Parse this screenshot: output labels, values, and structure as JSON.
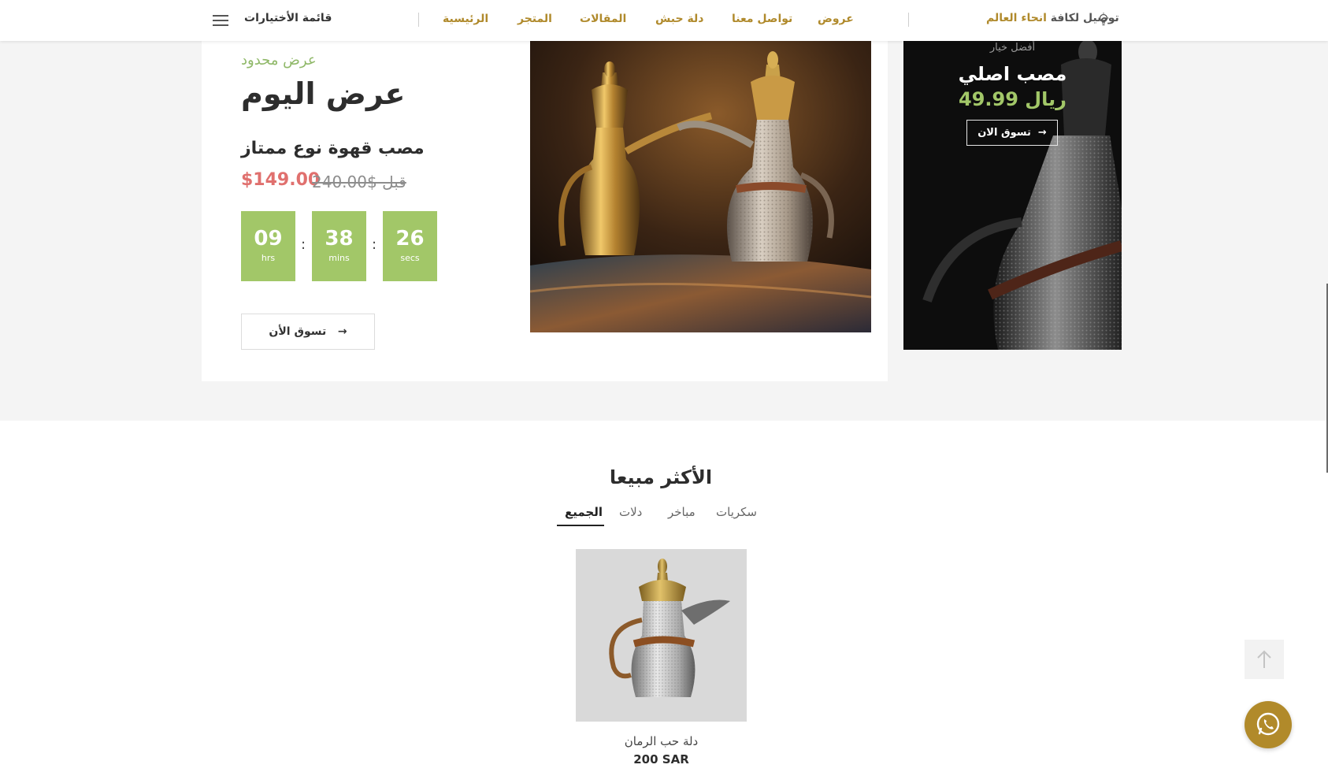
{
  "nav": {
    "menu_label": "قائمة الأختيارات",
    "items": [
      "الرئيسية",
      "المتجر",
      "المقالات",
      "دلة حبش",
      "تواصل معنا",
      "عروض"
    ],
    "shipping_prefix": "توصيل لكافة",
    "shipping_accent": "انحاء العالم"
  },
  "deal": {
    "subtitle": "عرض محدود",
    "title": "عرض اليوم",
    "product": "مصب قهوة نوع ممتاز",
    "price": "$149.00",
    "old_price": "قبل $240.00",
    "countdown": [
      {
        "value": "09",
        "unit": "hrs"
      },
      {
        "value": "38",
        "unit": "mins"
      },
      {
        "value": "26",
        "unit": "secs"
      }
    ],
    "countdown_separator": ":",
    "shop_button": "تسوق الأن"
  },
  "side_banner": {
    "kicker": "أفضل خيار",
    "title": "مصب اصلي",
    "price": "49.99 ريال",
    "button": "تسوق الان"
  },
  "best_sellers": {
    "title": "الأكثر مبيعا",
    "tabs": [
      {
        "label": "سكريات",
        "active": false
      },
      {
        "label": "مباخر",
        "active": false
      },
      {
        "label": "دلات",
        "active": false
      },
      {
        "label": "الجميع",
        "active": true
      }
    ],
    "products": [
      {
        "name": "دلة حب الرمان",
        "price": "200 SAR"
      }
    ]
  },
  "colors": {
    "gold_accent": "#b08a2c",
    "green_accent": "#a2c768",
    "sale_red": "#e0706e",
    "whatsapp_button": "#b18a2a"
  },
  "icons": {
    "menu": "hamburger-icon",
    "shipping": "lightbulb-icon",
    "arrow": "arrow-right-icon",
    "back_to_top": "arrow-up-icon",
    "chat": "whatsapp-icon"
  }
}
